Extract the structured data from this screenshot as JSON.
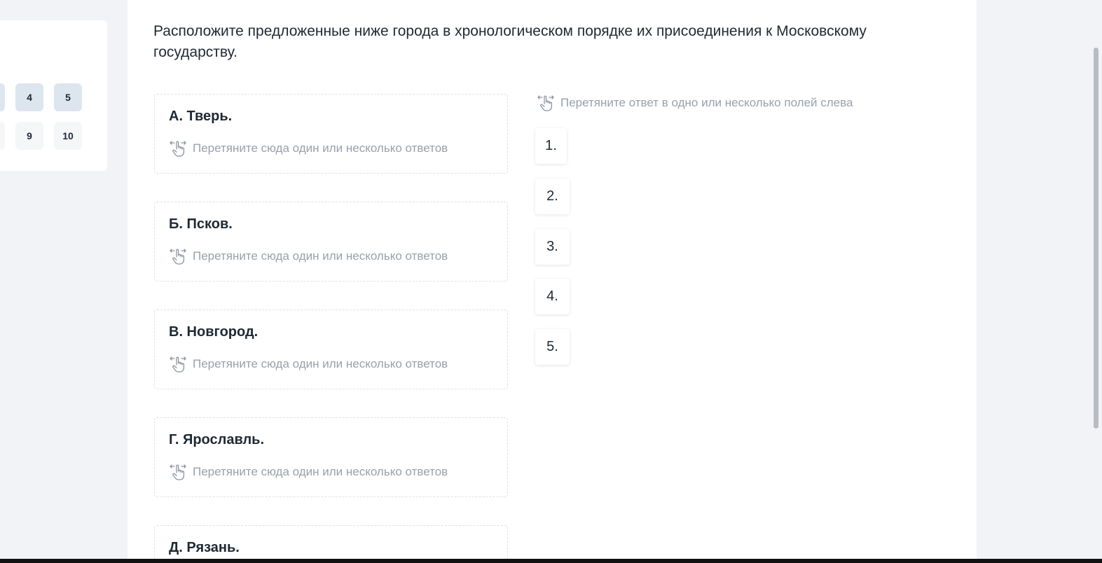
{
  "nav": {
    "buttons": [
      {
        "label": "4",
        "state": "answered"
      },
      {
        "label": "5",
        "state": "answered"
      },
      {
        "label": "9",
        "state": "plain"
      },
      {
        "label": "10",
        "state": "plain"
      }
    ]
  },
  "question": {
    "text": "Расположите предложенные ниже города в хронологическом порядке их присоединения к Московскому государству."
  },
  "drop_hint": "Перетяните сюда один или несколько ответов",
  "answers_hint": "Перетяните ответ в одно или несколько полей слева",
  "drop_zones": [
    {
      "label": "А. Тверь."
    },
    {
      "label": "Б. Псков."
    },
    {
      "label": "В. Новгород."
    },
    {
      "label": "Г. Ярославль."
    },
    {
      "label": "Д. Рязань."
    }
  ],
  "answers": [
    "1.",
    "2.",
    "3.",
    "4.",
    "5."
  ],
  "icons": {
    "drag": "drag-hand-icon"
  },
  "colors": {
    "page_bg": "#f1f3f6",
    "answered_bg": "#dde6ef",
    "hint_text": "#97a1ab",
    "text": "#1f2933"
  }
}
